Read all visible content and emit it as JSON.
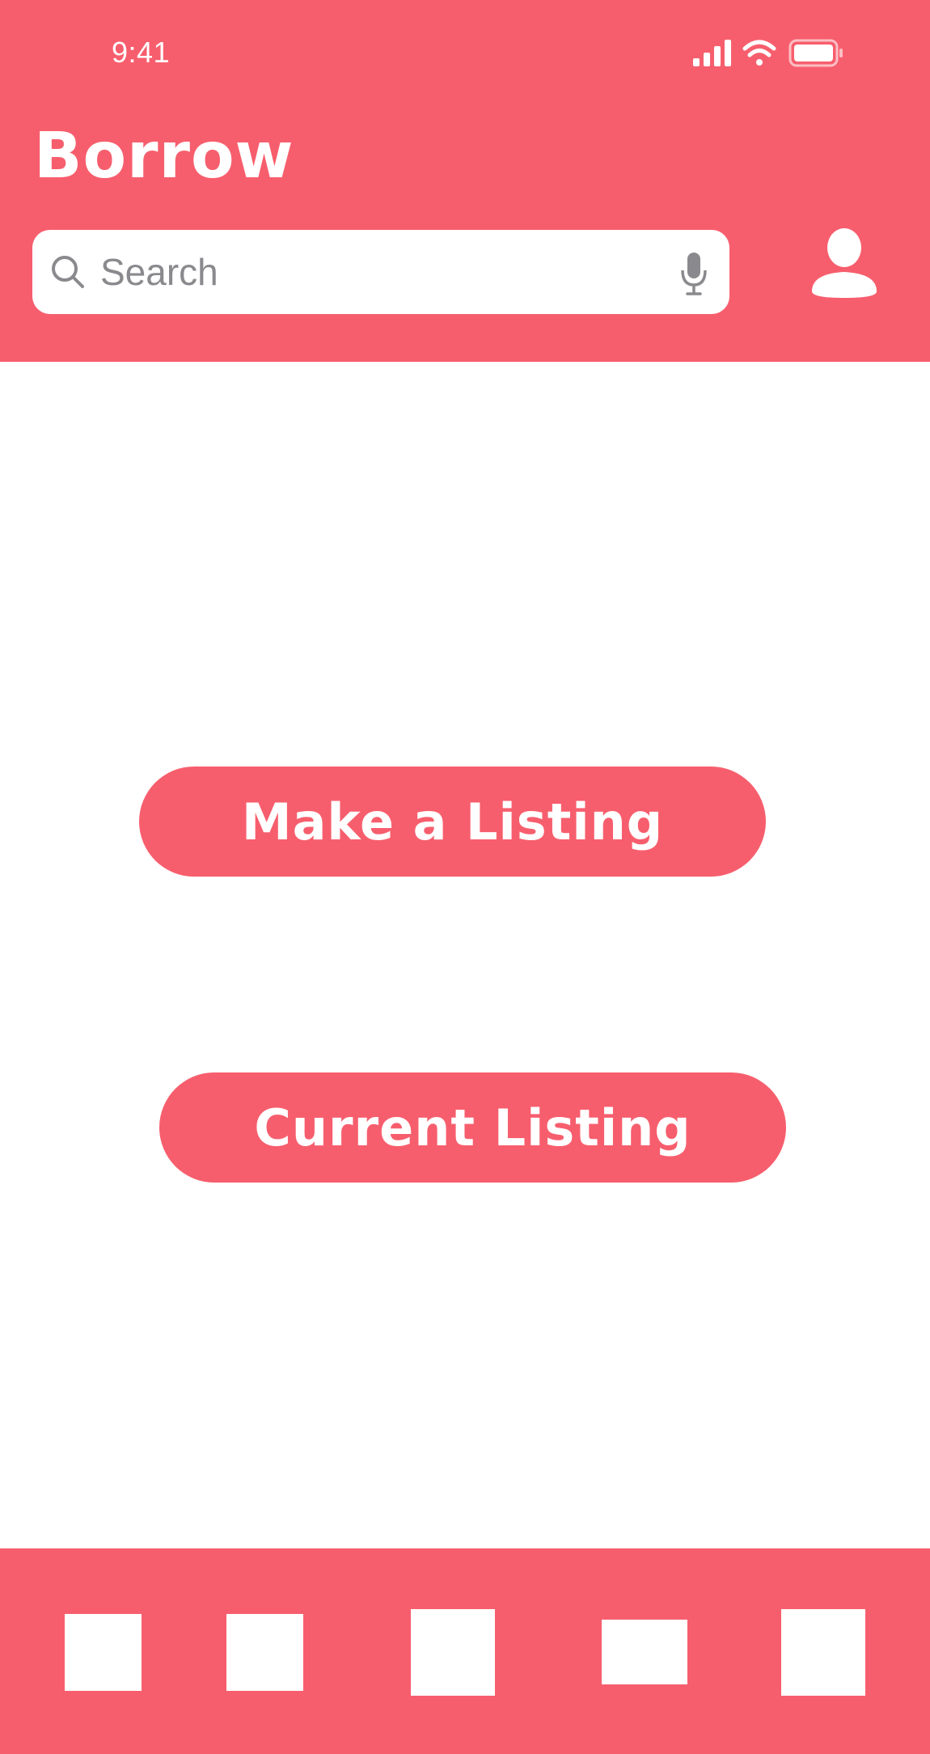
{
  "status_bar": {
    "time": "9:41",
    "icons": [
      "cellular-signal-icon",
      "wifi-icon",
      "battery-icon"
    ]
  },
  "header": {
    "title": "Borrow",
    "search": {
      "placeholder": "Search",
      "value": ""
    },
    "icons": [
      "search-icon",
      "mic-icon",
      "profile-icon"
    ]
  },
  "main": {
    "make_listing_label": "Make a Listing",
    "current_listing_label": "Current Listing"
  },
  "tab_bar": {
    "tabs": [
      {
        "icon": "tab-placeholder-1"
      },
      {
        "icon": "tab-placeholder-2"
      },
      {
        "icon": "tab-placeholder-3"
      },
      {
        "icon": "tab-placeholder-4"
      },
      {
        "icon": "tab-placeholder-5"
      }
    ]
  },
  "colors": {
    "accent": "#f75e6d",
    "background": "#ffffff",
    "placeholder_text": "#8a8a8e"
  }
}
